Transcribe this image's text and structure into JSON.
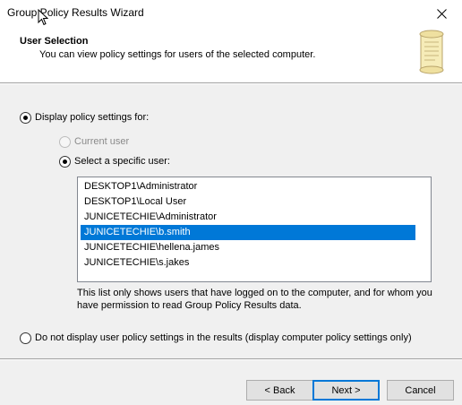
{
  "window": {
    "title": "Group Policy Results Wizard"
  },
  "header": {
    "title": "User Selection",
    "subtitle": "You can view policy settings for users of the selected computer."
  },
  "options": {
    "display_label": "Display policy settings for:",
    "display_checked": true,
    "current_user_label": "Current user",
    "current_user_enabled": false,
    "specific_user_label": "Select a specific user:",
    "specific_user_checked": true,
    "no_display_label": "Do not display user policy settings in the results (display computer policy settings only)"
  },
  "users": {
    "items": [
      "DESKTOP1\\Administrator",
      "DESKTOP1\\Local User",
      "JUNICETECHIE\\Administrator",
      "JUNICETECHIE\\b.smith",
      "JUNICETECHIE\\hellena.james",
      "JUNICETECHIE\\s.jakes"
    ],
    "selected": "JUNICETECHIE\\b.smith",
    "note": "This list only shows users that have logged on to the computer, and for whom you have permission to read Group Policy Results data."
  },
  "buttons": {
    "back": "< Back",
    "next": "Next >",
    "cancel": "Cancel"
  },
  "colors": {
    "selection": "#0078d7",
    "window_bg": "#f0f0f0",
    "header_bg": "#ffffff"
  },
  "icons": {
    "close": "close-icon",
    "header": "scroll-icon",
    "cursor": "mouse-pointer-icon"
  }
}
